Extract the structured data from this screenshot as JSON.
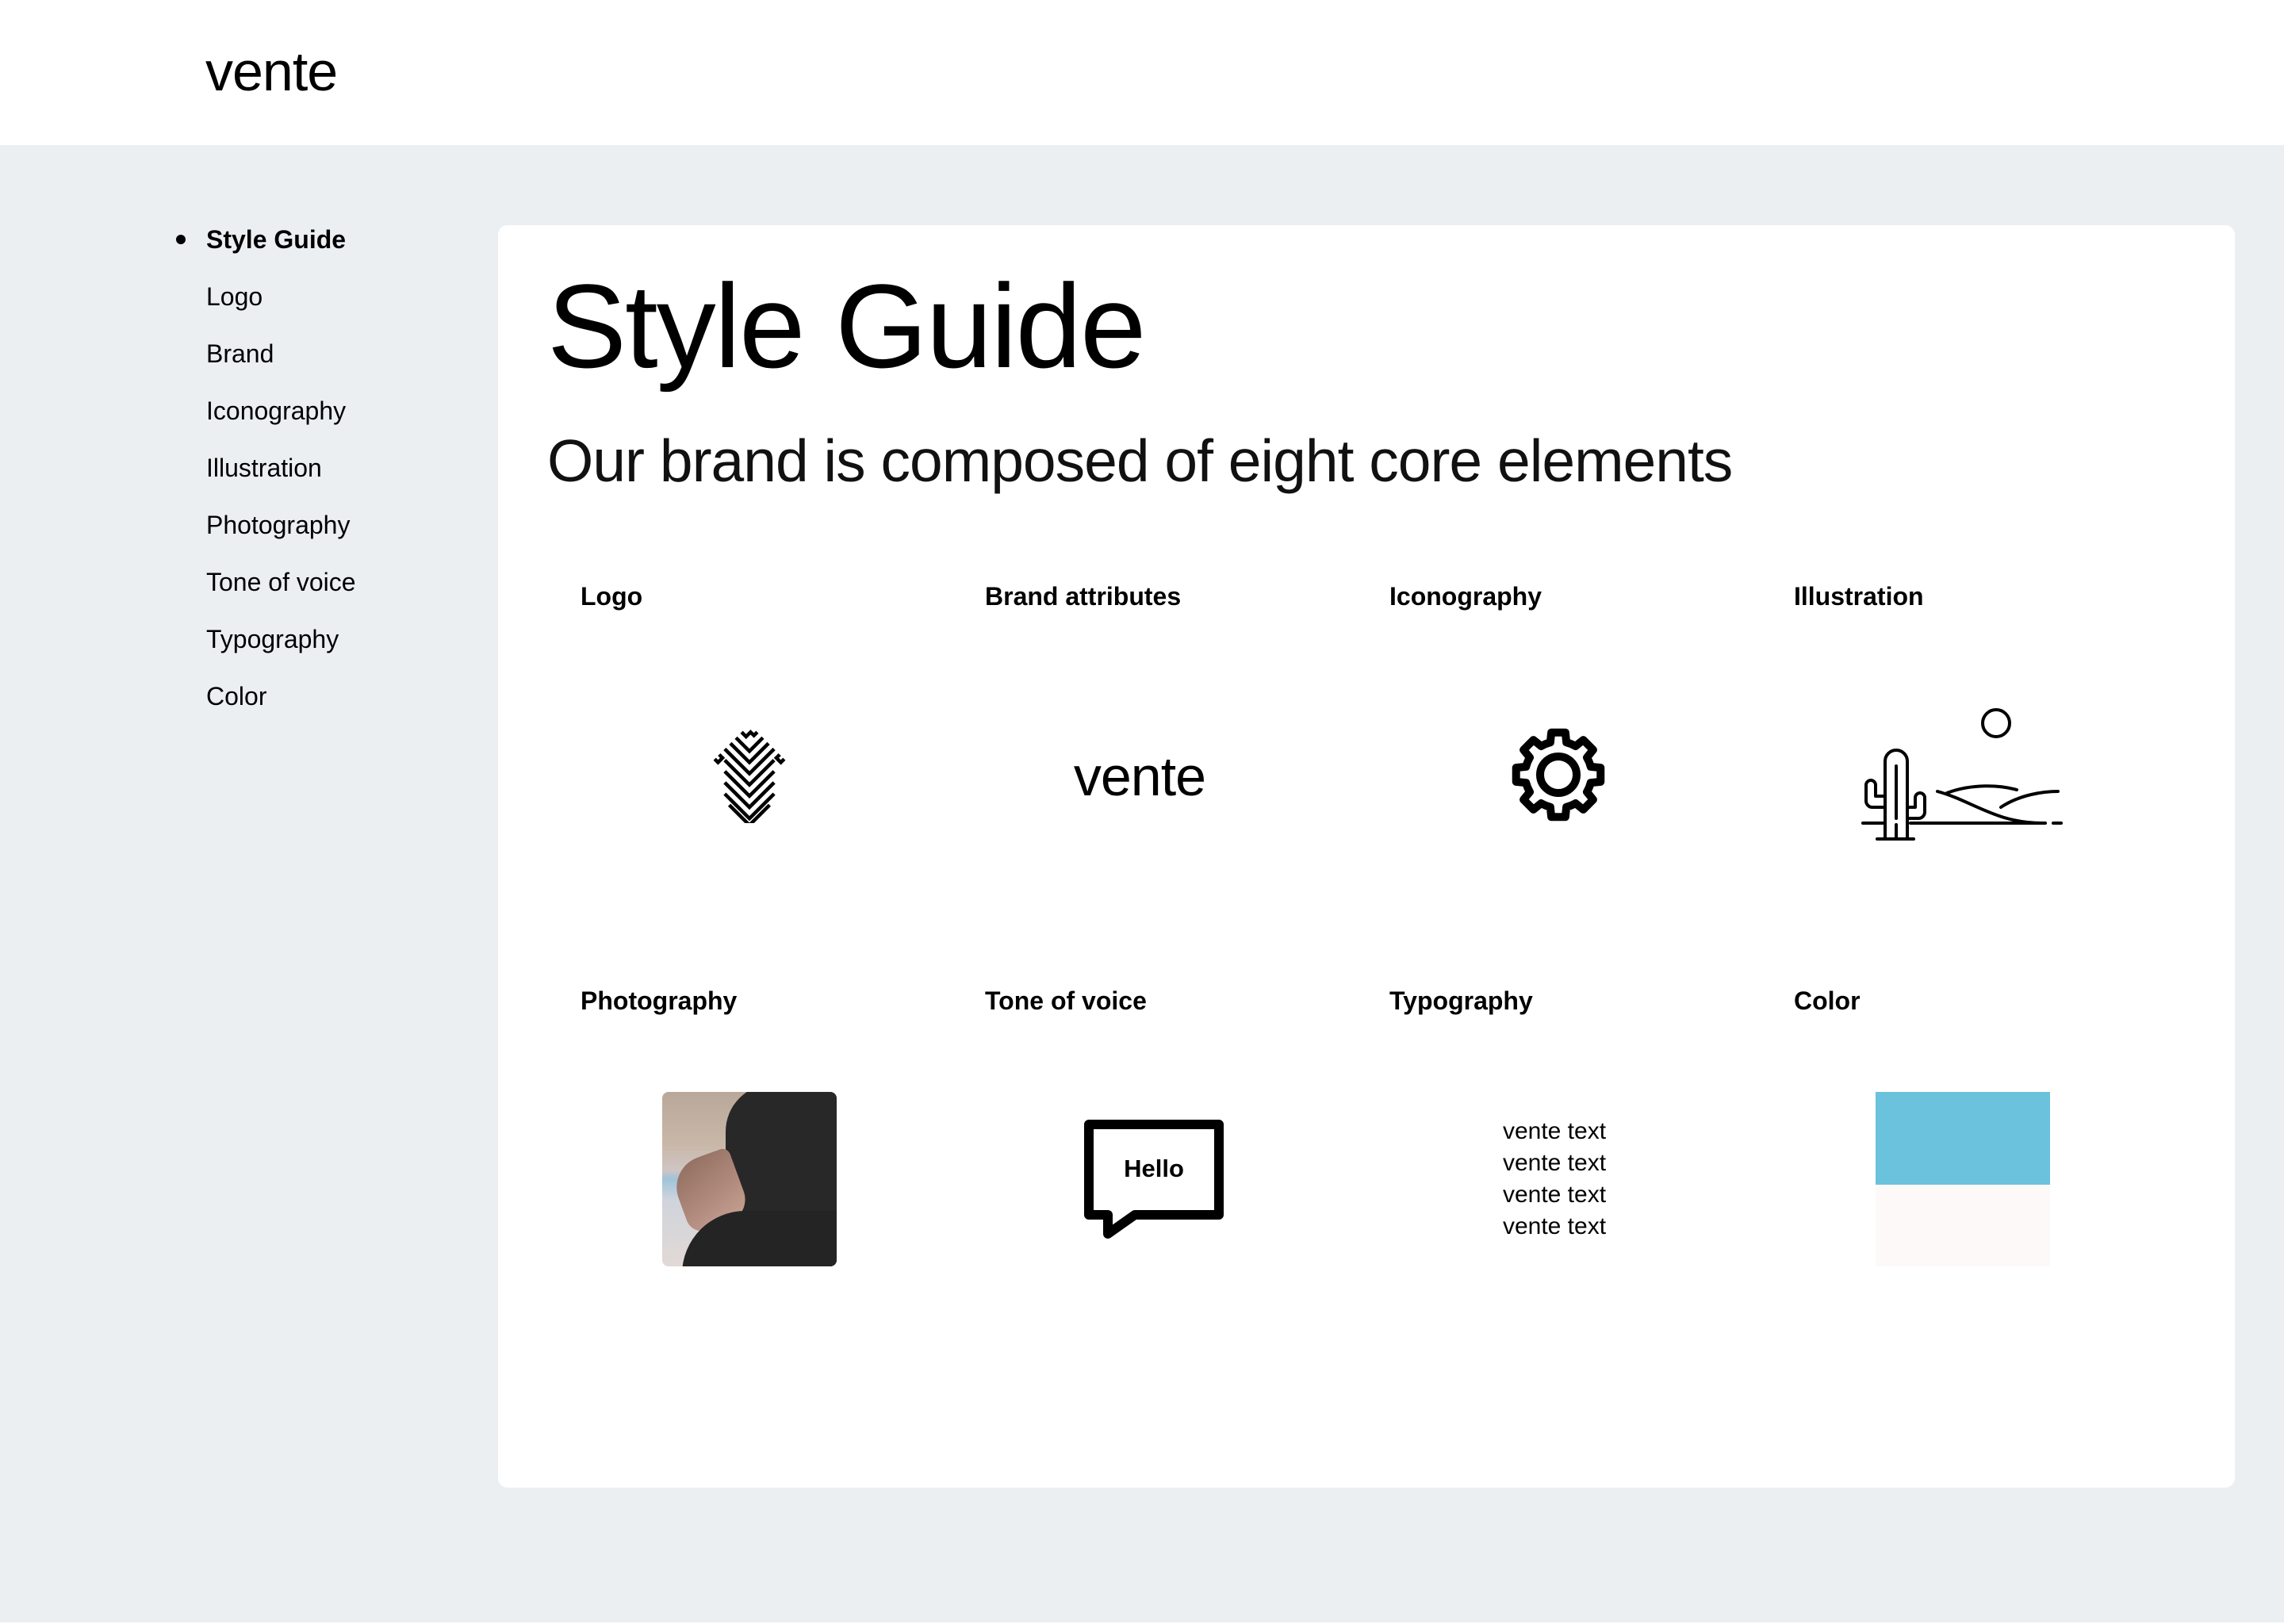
{
  "header": {
    "brand": "vente"
  },
  "sidebar": {
    "items": [
      {
        "label": "Style Guide",
        "active": true
      },
      {
        "label": "Logo",
        "active": false
      },
      {
        "label": "Brand",
        "active": false
      },
      {
        "label": "Iconography",
        "active": false
      },
      {
        "label": "Illustration",
        "active": false
      },
      {
        "label": "Photography",
        "active": false
      },
      {
        "label": "Tone of voice",
        "active": false
      },
      {
        "label": "Typography",
        "active": false
      },
      {
        "label": "Color",
        "active": false
      }
    ]
  },
  "main": {
    "title": "Style Guide",
    "subtitle": "Our brand is composed of eight core elements",
    "elements": [
      {
        "label": "Logo",
        "visual": "logo-mark-icon"
      },
      {
        "label": "Brand attributes",
        "visual": "wordmark",
        "wordmark": "vente"
      },
      {
        "label": "Iconography",
        "visual": "gear-icon"
      },
      {
        "label": "Illustration",
        "visual": "desert-cactus-illustration"
      },
      {
        "label": "Photography",
        "visual": "meditation-photo"
      },
      {
        "label": "Tone of voice",
        "visual": "speech-bubble-icon",
        "bubble_text": "Hello"
      },
      {
        "label": "Typography",
        "visual": "text-sample",
        "lines": [
          "vente text",
          "vente text",
          "vente text",
          "vente text"
        ]
      },
      {
        "label": "Color",
        "visual": "color-swatch",
        "colors": [
          "#6AC2DC",
          "#FCF9F8"
        ]
      }
    ]
  }
}
